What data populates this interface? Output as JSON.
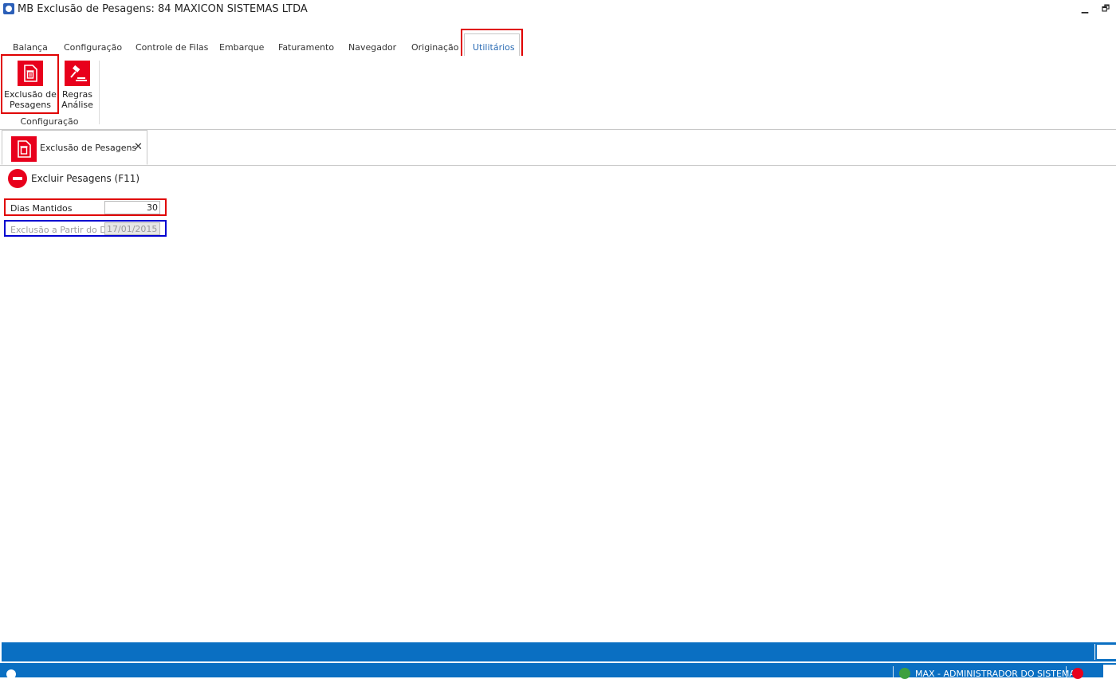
{
  "window": {
    "title": "MB Exclusão de Pesagens: 84 MAXICON SISTEMAS LTDA",
    "minimize": "▁",
    "restore": "🗗"
  },
  "ribbon": {
    "tabs": [
      {
        "label": "Balança"
      },
      {
        "label": "Configuração"
      },
      {
        "label": "Controle de Filas"
      },
      {
        "label": "Embarque"
      },
      {
        "label": "Faturamento"
      },
      {
        "label": "Navegador"
      },
      {
        "label": "Originação"
      },
      {
        "label": "Utilitários"
      }
    ],
    "active_tab": "Utilitários",
    "buttons": {
      "exclusao_line1": "Exclusão de",
      "exclusao_line2": "Pesagens",
      "regras_line1": "Regras",
      "regras_line2": "Análise"
    },
    "group_label": "Configuração"
  },
  "document_tab": {
    "label": "Exclusão de Pesagens",
    "close": "✕"
  },
  "toolbar": {
    "excluir_label": "Excluir Pesagens (F11)"
  },
  "form": {
    "dias_mantidos_label": "Dias Mantidos",
    "dias_mantidos_value": "30",
    "exclusao_label": "Exclusão a Partir do Dia",
    "exclusao_value": "17/01/2015"
  },
  "taskbar": {
    "user": "MAX - ADMINISTRADOR DO SISTEMA"
  },
  "colors": {
    "accent_red": "#e8001c",
    "statusbar_blue": "#0a6fc2",
    "active_tab_text": "#2d6db5"
  }
}
